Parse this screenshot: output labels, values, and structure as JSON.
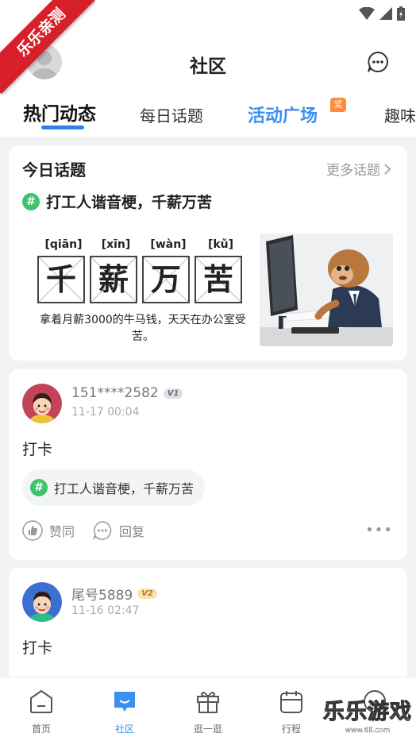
{
  "corner_ribbon": "乐乐亲测",
  "header": {
    "title": "社区"
  },
  "tabs": [
    {
      "label": "热门动态"
    },
    {
      "label": "每日话题"
    },
    {
      "label": "活动广场",
      "badge": "奖"
    },
    {
      "label": "趣味"
    }
  ],
  "topic_card": {
    "heading": "今日话题",
    "more_label": "更多话题",
    "topic_title": "打工人谐音梗，千薪万苦",
    "banner": {
      "pinyin": [
        "[qiān]",
        "[xīn]",
        "[wàn]",
        "[kǔ]"
      ],
      "chars": [
        "千",
        "薪",
        "万",
        "苦"
      ],
      "caption": "拿着月薪3000的牛马钱，天天在办公室受苦。"
    }
  },
  "posts": [
    {
      "user": "151****2582",
      "level": "V1",
      "time": "11-17 00:04",
      "text": "打卡",
      "topic": "打工人谐音梗，千薪万苦",
      "like_label": "赞同",
      "reply_label": "回复"
    },
    {
      "user": "尾号5889",
      "level": "V2",
      "time": "11-16 02:47",
      "text": "打卡"
    }
  ],
  "bottom_nav": [
    {
      "label": "首页"
    },
    {
      "label": "社区"
    },
    {
      "label": "逛一逛"
    },
    {
      "label": "行程"
    },
    {
      "label": ""
    }
  ],
  "watermark": {
    "main": "乐乐游戏",
    "url": "www.6ll.com"
  },
  "colors": {
    "accent": "#3a8ff0",
    "topic_green": "#3ec46d",
    "ribbon_red": "#d8202a"
  }
}
